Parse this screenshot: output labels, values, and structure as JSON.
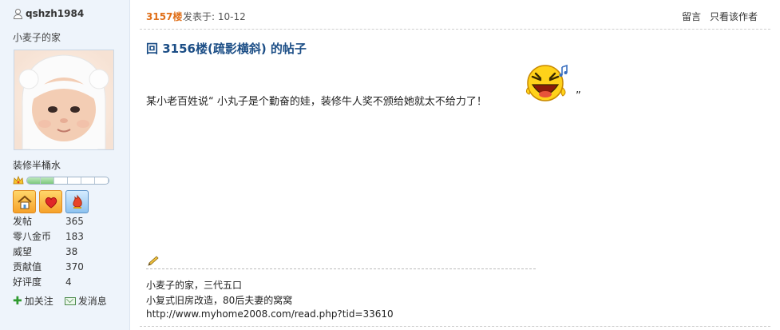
{
  "sidebar": {
    "username": "qshzh1984",
    "home_name": "小麦子的家",
    "rank": "装修半桶水",
    "level_filled": 0.3,
    "stats": [
      {
        "label": "发帖",
        "value": "365"
      },
      {
        "label": "零八金币",
        "value": "183"
      },
      {
        "label": "威望",
        "value": "38"
      },
      {
        "label": "贡献值",
        "value": "370"
      },
      {
        "label": "好评度",
        "value": "4"
      }
    ],
    "add_follow": "加关注",
    "send_message": "发消息"
  },
  "post": {
    "floor": "3157楼",
    "posted_at": "发表于: 10-12",
    "reply_label": "留言",
    "author_only_label": "只看该作者",
    "title": "回  3156楼(疏影横斜) 的帖子",
    "body": "某小老百姓说“ 小丸子是个勤奋的娃，装修牛人奖不颁给她就太不给力了！",
    "close_quote": "”",
    "signature": [
      "小麦子的家，三代五口",
      "小复式旧房改造，80后夫妻的窝窝",
      "http://www.myhome2008.com/read.php?tid=33610"
    ]
  },
  "colors": {
    "floor": "#e0701a",
    "title": "#1c4e86",
    "sidebar_bg": "#eef4fb"
  },
  "icons": [
    "user-icon",
    "crown-icon",
    "house-badge-icon",
    "heart-badge-icon",
    "flame-badge-icon",
    "plus-icon",
    "mail-icon",
    "laughing-emoji-icon",
    "pencil-icon"
  ]
}
